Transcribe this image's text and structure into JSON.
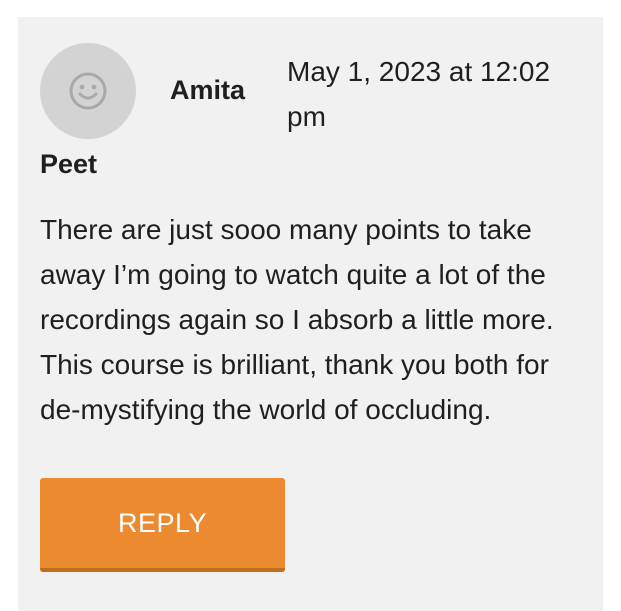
{
  "comment": {
    "avatar_icon": "smiley-face-icon",
    "author_first": "Amita",
    "author_last": "Peet",
    "date_line1": "May 1, 2023 at 12:02",
    "date_line2": "pm",
    "body_lines": [
      "There are just sooo many points to take",
      "away I’m going to watch quite a lot of the",
      "recordings again so I absorb a little more.",
      "This course is brilliant, thank you both for",
      "de-mystifying the world of occluding."
    ],
    "reply_label": "REPLY"
  },
  "colors": {
    "card_background": "#f1f1f1",
    "avatar_background": "#d3d3d3",
    "reply_button": "#eb8a2f",
    "text": "#1f1f1f"
  }
}
